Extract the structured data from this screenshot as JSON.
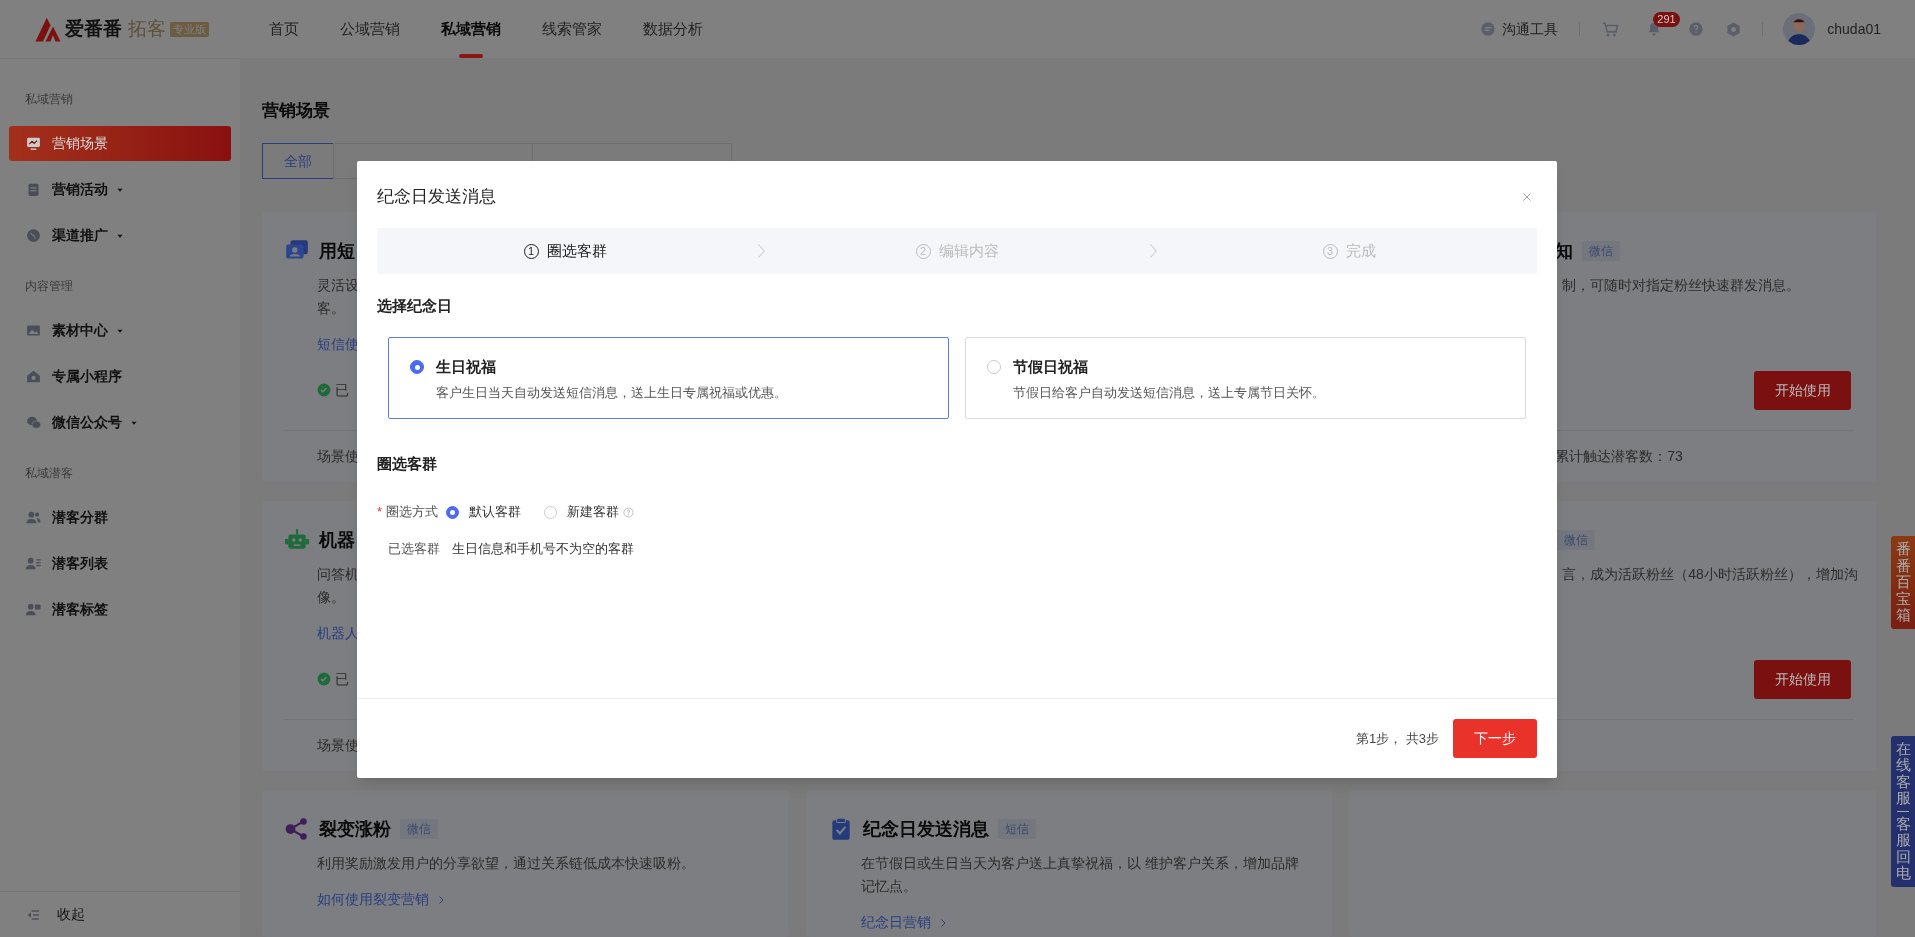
{
  "header": {
    "logo": {
      "brand": "爱番番",
      "product": "拓客",
      "edition": "专业版"
    },
    "nav": [
      {
        "label": "首页",
        "selected": false
      },
      {
        "label": "公域营销",
        "selected": false
      },
      {
        "label": "私域营销",
        "selected": true
      },
      {
        "label": "线索管家",
        "selected": false
      },
      {
        "label": "数据分析",
        "selected": false
      }
    ],
    "chat_tool": "沟通工具",
    "notification_count": "291",
    "user": "chuda01"
  },
  "sidebar": {
    "groups": [
      {
        "title": "私域营销",
        "items": [
          {
            "label": "营销场景",
            "selected": true,
            "has_dropdown": false
          },
          {
            "label": "营销活动",
            "selected": false,
            "has_dropdown": true
          },
          {
            "label": "渠道推广",
            "selected": false,
            "has_dropdown": true
          }
        ]
      },
      {
        "title": "内容管理",
        "items": [
          {
            "label": "素材中心",
            "selected": false,
            "has_dropdown": true
          },
          {
            "label": "专属小程序",
            "selected": false,
            "has_dropdown": false
          },
          {
            "label": "微信公众号",
            "selected": false,
            "has_dropdown": true
          }
        ]
      },
      {
        "title": "私域潜客",
        "items": [
          {
            "label": "潜客分群",
            "selected": false,
            "has_dropdown": false
          },
          {
            "label": "潜客列表",
            "selected": false,
            "has_dropdown": false
          },
          {
            "label": "潜客标签",
            "selected": false,
            "has_dropdown": false
          }
        ]
      }
    ],
    "collapse": "收起"
  },
  "main": {
    "title": "营销场景",
    "tabs": [
      {
        "label": "全部",
        "selected": true
      },
      {
        "selected": false
      },
      {
        "selected": false
      }
    ],
    "cards_row_1": {
      "left": {
        "title": "用短",
        "description": [
          "灵活设",
          "客。"
        ],
        "link": "短信使",
        "status": "已",
        "footer": "场景使"
      },
      "right": {
        "title": "知",
        "tag": "微信",
        "description": [
          "制，可随时对指定粉丝快速群发消息。"
        ],
        "button": "开始使用",
        "footer": "累计触达潜客数：73"
      }
    },
    "cards_row_2": {
      "left": {
        "title": "机器",
        "description": [
          "问答机",
          "像。"
        ],
        "link": "机器人",
        "status": "已",
        "footer": "场景使"
      },
      "right": {
        "tag": "微信",
        "description": [
          "言，成为活跃粉丝（48小时活跃粉丝），增加沟"
        ],
        "button": "开始使用"
      }
    },
    "cards_row_3": {
      "left": {
        "title": "裂变涨粉",
        "tag": "微信",
        "description": [
          "利用奖励激发用户的分享欲望，通过关系链低成本快速吸粉。"
        ],
        "link": "如何使用裂变营销"
      },
      "middle": {
        "title": "纪念日发送消息",
        "tag": "短信",
        "description": [
          "在节假日或生日当天为客户送上真挚祝福，以 维护客户关系，增加品牌",
          "记忆点。"
        ],
        "link": "纪念日营销"
      }
    }
  },
  "side_widgets": [
    {
      "kind": "toolbox",
      "texts": [
        "番番百宝箱"
      ]
    },
    {
      "kind": "service",
      "texts": [
        "在线客服",
        "客服回电"
      ]
    }
  ],
  "dialog": {
    "title": "纪念日发送消息",
    "steps": [
      {
        "number": "1",
        "label": "圈选客群",
        "selected": true
      },
      {
        "number": "2",
        "label": "编辑内容",
        "selected": false
      },
      {
        "number": "3",
        "label": "完成",
        "selected": false
      }
    ],
    "section_1": "选择纪念日",
    "options": [
      {
        "title": "生日祝福",
        "description": "客户生日当天自动发送短信消息，送上生日专属祝福或优惠。",
        "selected": true
      },
      {
        "title": "节假日祝福",
        "description": "节假日给客户自动发送短信消息，送上专属节日关怀。",
        "selected": false
      }
    ],
    "section_2": "圈选客群",
    "selection_method": {
      "required_mark": "*",
      "label": "圈选方式",
      "choices": [
        {
          "label": "默认客群",
          "selected": true,
          "help": false
        },
        {
          "label": "新建客群",
          "selected": false,
          "help": true
        }
      ]
    },
    "selected_group": {
      "label": "已选客群",
      "value": "生日信息和手机号不为空的客群"
    },
    "footer": {
      "progress": "第1步， 共3步",
      "next_button": "下一步"
    }
  }
}
